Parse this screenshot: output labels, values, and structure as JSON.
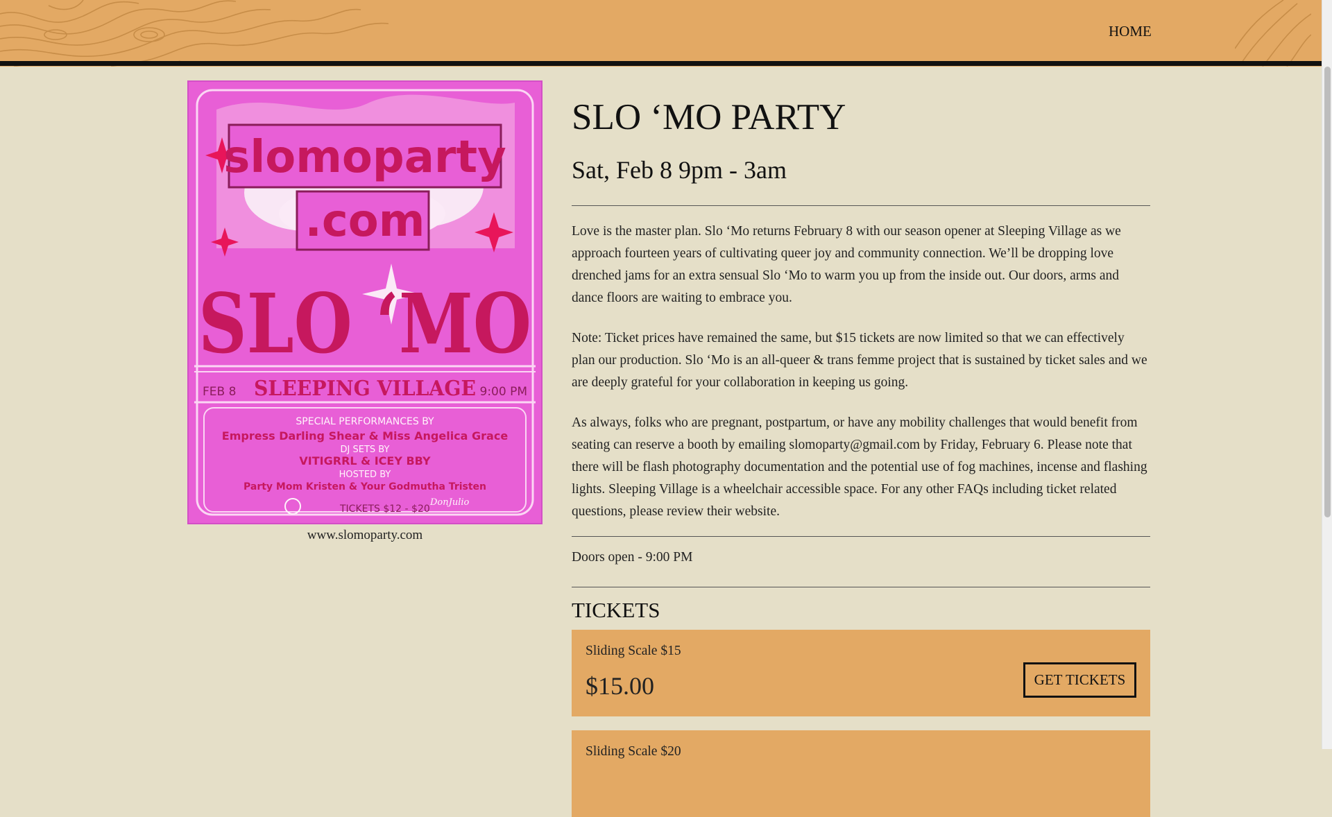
{
  "nav": {
    "home": "HOME"
  },
  "poster": {
    "url_line1": "slomoparty",
    "url_line2": ".com",
    "big_title": "SLO ‘MO",
    "venue": "SLEEPING VILLAGE",
    "date": "FEB 8",
    "time": "9:00 PM",
    "perf_label": "SPECIAL PERFORMANCES BY",
    "performers": "Empress Darling Shear & Miss Angelica Grace",
    "dj_label": "DJ SETS BY",
    "djs": "VITIGRRL & ICEY BBY",
    "hosted_label": "HOSTED BY",
    "hosts": "Party Mom Kristen & Your Godmutha Tristen",
    "tickets": "TICKETS $12 - $20",
    "sponsor": "DonJulio",
    "caption": "www.slomoparty.com"
  },
  "event": {
    "title": "SLO ‘MO PARTY",
    "date": "Sat, Feb 8 9pm - 3am",
    "paragraphs": [
      "Love is the master plan. Slo ‘Mo returns February 8 with our season opener at Sleeping Village as we approach fourteen years of cultivating queer joy and community connection. We’ll be dropping love drenched jams for an extra sensual Slo ‘Mo to warm you up from the inside out. Our doors, arms and dance floors are waiting to embrace you.",
      "Note: Ticket prices have remained the same, but $15 tickets are now limited so that we can effectively plan our production. Slo ‘Mo is an all-queer & trans femme project that is sustained by ticket sales and we are deeply grateful for your collaboration in keeping us going.",
      "As always, folks who are pregnant, postpartum, or have any mobility challenges that would benefit from seating can reserve a booth by emailing slomoparty@gmail.com by Friday, February 6. Please note that there will be flash photography documentation and the potential use of fog machines, incense and flashing lights. Sleeping Village is a wheelchair accessible space. For any other FAQs including ticket related questions, please review their website."
    ],
    "doors": "Doors open - 9:00 PM"
  },
  "tickets": {
    "heading": "TICKETS",
    "items": [
      {
        "name": "Sliding Scale $15",
        "price": "$15.00",
        "button": "GET TICKETS"
      },
      {
        "name": "Sliding Scale $20"
      }
    ]
  },
  "colors": {
    "background": "#e5dfc8",
    "header": "#e3a964",
    "poster_pink": "#e85fd6",
    "poster_magenta": "#d4145a"
  }
}
